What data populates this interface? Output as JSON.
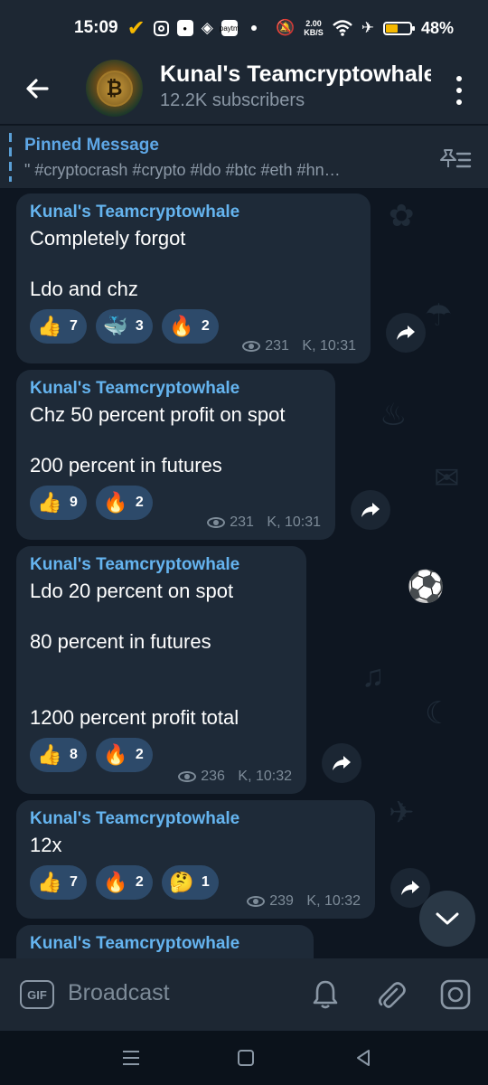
{
  "status_bar": {
    "time": "15:09",
    "speed_value": "2.00",
    "speed_unit": "KB/S",
    "battery": "48%",
    "battery_level": 0.48,
    "app_badge": "paytm"
  },
  "header": {
    "channel_name": "Kunal's Teamcryptowhale",
    "subscribers": "12.2K subscribers"
  },
  "pinned": {
    "label": "Pinned Message",
    "text": "\" #cryptocrash #crypto #ldo #btc   #eth #hn…"
  },
  "messages": [
    {
      "author": "Kunal's Teamcryptowhale",
      "text": "Completely forgot\n\nLdo and chz",
      "reactions": [
        {
          "emoji": "👍",
          "icon": "thumbs-up",
          "count": "7"
        },
        {
          "emoji": "🐳",
          "icon": "whale",
          "count": "3"
        },
        {
          "emoji": "🔥",
          "icon": "fire",
          "count": "2"
        }
      ],
      "views": "231",
      "signature_time": "K, 10:31"
    },
    {
      "author": "Kunal's Teamcryptowhale",
      "text": "Chz 50 percent profit on spot\n\n200 percent in futures",
      "reactions": [
        {
          "emoji": "👍",
          "icon": "thumbs-up",
          "count": "9"
        },
        {
          "emoji": "🔥",
          "icon": "fire",
          "count": "2"
        }
      ],
      "views": "231",
      "signature_time": "K, 10:31"
    },
    {
      "author": "Kunal's Teamcryptowhale",
      "text": "Ldo 20 percent on spot\n\n80 percent in futures\n\n\n1200 percent profit total",
      "reactions": [
        {
          "emoji": "👍",
          "icon": "thumbs-up",
          "count": "8"
        },
        {
          "emoji": "🔥",
          "icon": "fire",
          "count": "2"
        }
      ],
      "views": "236",
      "signature_time": "K, 10:32"
    },
    {
      "author": "Kunal's Teamcryptowhale",
      "text": "12x",
      "reactions": [
        {
          "emoji": "👍",
          "icon": "thumbs-up",
          "count": "7"
        },
        {
          "emoji": "🔥",
          "icon": "fire",
          "count": "2"
        },
        {
          "emoji": "🤔",
          "icon": "thinking-face",
          "count": "1"
        }
      ],
      "views": "239",
      "signature_time": "K, 10:32"
    },
    {
      "author": "Kunal's Teamcryptowhale"
    }
  ],
  "bottom_bar": {
    "gif_label": "GIF",
    "placeholder": "Broadcast"
  },
  "colors": {
    "background": "#0e1621",
    "bar": "#1d2733",
    "bubble": "#1e2a38",
    "accent": "#65b4ef",
    "reaction": "#2d4a6a"
  }
}
